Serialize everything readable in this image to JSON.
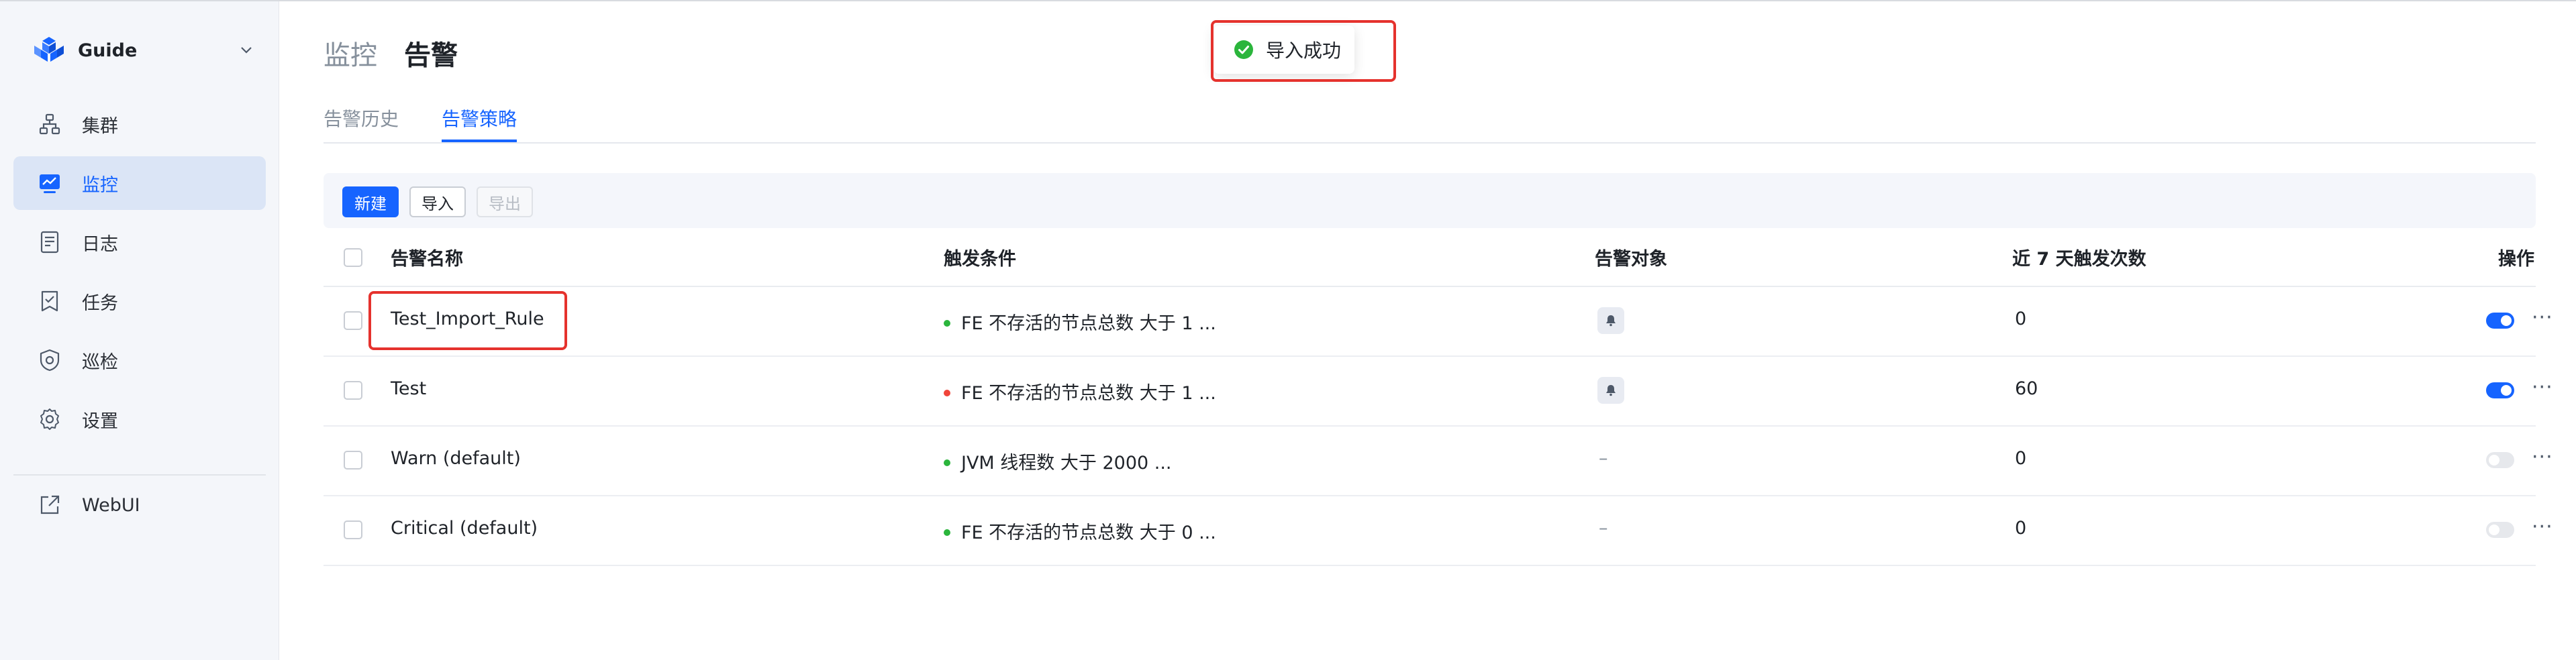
{
  "app": {
    "name": "Guide"
  },
  "sidebar": {
    "items": [
      {
        "label": "集群",
        "icon": "cluster-icon",
        "active": false
      },
      {
        "label": "监控",
        "icon": "monitor-icon",
        "active": true
      },
      {
        "label": "日志",
        "icon": "log-icon",
        "active": false
      },
      {
        "label": "任务",
        "icon": "task-icon",
        "active": false
      },
      {
        "label": "巡检",
        "icon": "inspection-shield-icon",
        "active": false
      },
      {
        "label": "设置",
        "icon": "settings-gear-icon",
        "active": false
      }
    ],
    "external": {
      "label": "WebUI",
      "icon": "external-link-icon"
    }
  },
  "breadcrumb": {
    "parent": "监控",
    "current": "告警"
  },
  "tabs": [
    {
      "label": "告警历史",
      "active": false
    },
    {
      "label": "告警策略",
      "active": true
    }
  ],
  "toolbar": {
    "new_label": "新建",
    "import_label": "导入",
    "export_label": "导出"
  },
  "table": {
    "columns": [
      "告警名称",
      "触发条件",
      "告警对象",
      "近 7 天触发次数",
      "操作"
    ],
    "rows": [
      {
        "name": "Test_Import_Rule",
        "condition": "FE 不存活的节点总数 大于 1 ...",
        "status_color": "green",
        "target": "bell",
        "count": "0",
        "enabled": true
      },
      {
        "name": "Test",
        "condition": "FE 不存活的节点总数 大于 1 ...",
        "status_color": "red",
        "target": "bell",
        "count": "60",
        "enabled": true
      },
      {
        "name": "Warn (default)",
        "condition": "JVM 线程数 大于 2000 ...",
        "status_color": "green",
        "target": "–",
        "count": "0",
        "enabled": false
      },
      {
        "name": "Critical (default)",
        "condition": "FE 不存活的节点总数 大于 0 ...",
        "status_color": "green",
        "target": "–",
        "count": "0",
        "enabled": false
      }
    ]
  },
  "toast": {
    "message": "导入成功",
    "icon": "check-circle-icon"
  },
  "colors": {
    "accent": "#1664ff",
    "success": "#2bb53c",
    "danger": "#f0453a",
    "highlight": "#e5322d"
  }
}
